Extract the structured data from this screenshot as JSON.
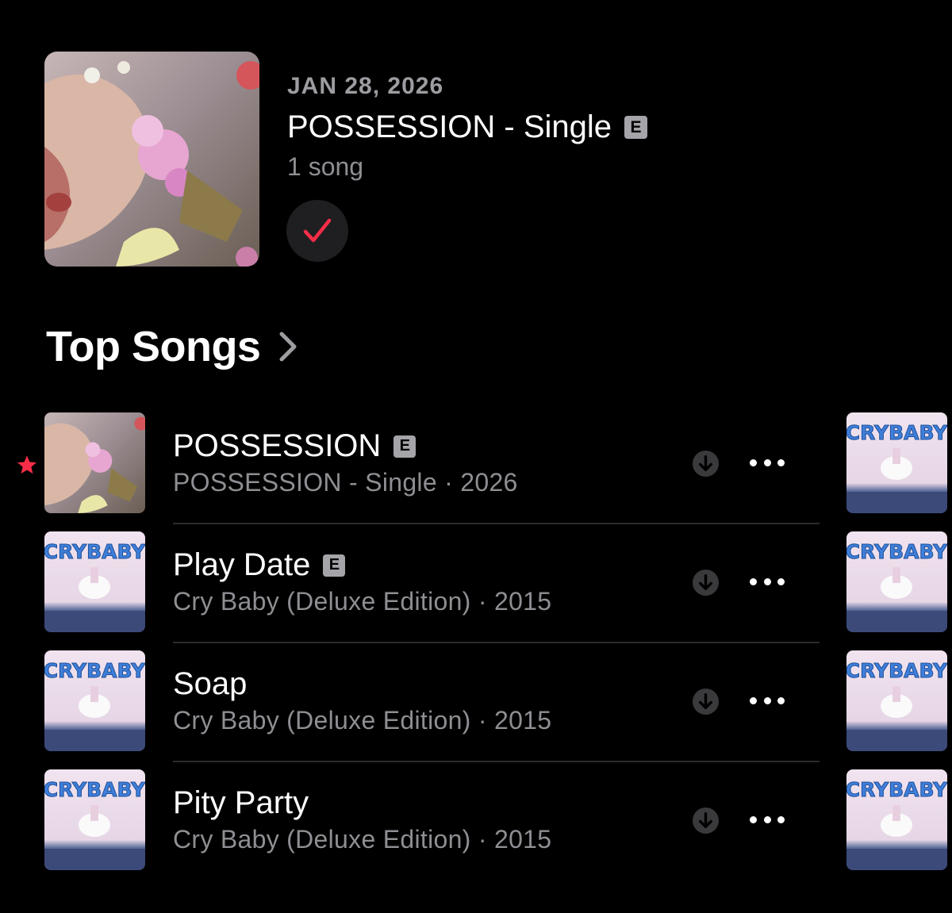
{
  "latest_release": {
    "date": "JAN 28, 2026",
    "title": "POSSESSION - Single",
    "explicit_badge": "E",
    "song_count": "1 song",
    "added_icon": "checkmark-icon",
    "accent_color": "#fa2d48"
  },
  "top_songs": {
    "title": "Top Songs",
    "chevron_icon": "chevron-right-icon",
    "rows": [
      {
        "title": "POSSESSION",
        "explicit": "E",
        "subtitle": "POSSESSION - Single · 2026",
        "art": "possession-cover",
        "favorite": true
      },
      {
        "title": "Play Date",
        "explicit": "E",
        "subtitle": "Cry Baby (Deluxe Edition) · 2015",
        "art": "crybaby-cover",
        "favorite": false
      },
      {
        "title": "Soap",
        "explicit": "",
        "subtitle": "Cry Baby (Deluxe Edition) · 2015",
        "art": "crybaby-cover",
        "favorite": false
      },
      {
        "title": "Pity Party",
        "explicit": "",
        "subtitle": "Cry Baby (Deluxe Edition) · 2015",
        "art": "crybaby-cover",
        "favorite": false
      }
    ],
    "side_art": [
      "crybaby-cover",
      "crybaby-cover",
      "crybaby-cover",
      "crybaby-cover"
    ],
    "side_art_text": "CRYBABY",
    "download_icon": "download-icon",
    "more_icon": "more-ellipsis-icon",
    "favorite_icon": "star-icon"
  }
}
